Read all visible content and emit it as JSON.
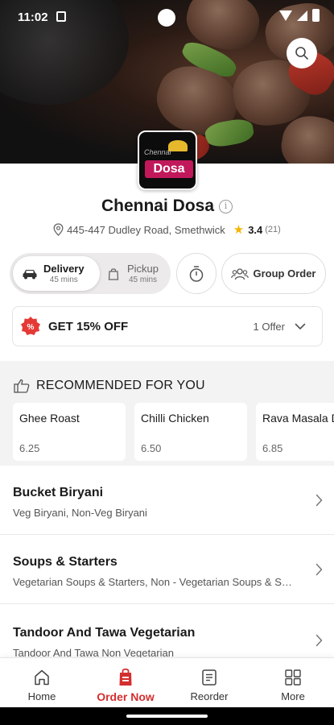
{
  "status_bar": {
    "time": "11:02"
  },
  "restaurant": {
    "name": "Chennai Dosa",
    "logo_small_text": "Chennai",
    "logo_text": "Dosa",
    "address": "445-447 Dudley Road, Smethwick",
    "rating": "3.4",
    "rating_count": "(21)"
  },
  "order_modes": {
    "delivery": {
      "label": "Delivery",
      "time": "45 mins",
      "selected": true
    },
    "pickup": {
      "label": "Pickup",
      "time": "45 mins",
      "selected": false
    }
  },
  "group_order_label": "Group Order",
  "offer": {
    "title": "GET 15% OFF",
    "count": "1 Offer"
  },
  "recommended": {
    "heading": "RECOMMENDED FOR YOU",
    "items": [
      {
        "name": "Ghee Roast",
        "price": "6.25"
      },
      {
        "name": "Chilli Chicken",
        "price": "6.50"
      },
      {
        "name": "Rava Masala Dosa",
        "price": "6.85"
      }
    ]
  },
  "categories": [
    {
      "name": "Bucket Biryani",
      "description": "Veg Biryani, Non-Veg Biryani"
    },
    {
      "name": "Soups & Starters",
      "description": "Vegetarian Soups & Starters, Non - Vegetarian Soups & Starters"
    },
    {
      "name": "Tandoor And Tawa Vegetarian",
      "description": "Tandoor And Tawa Non Vegetarian"
    }
  ],
  "bottom_nav": [
    {
      "label": "Home",
      "icon": "home-icon"
    },
    {
      "label": "Order Now",
      "icon": "order-bag-icon",
      "active": true
    },
    {
      "label": "Reorder",
      "icon": "receipt-icon"
    },
    {
      "label": "More",
      "icon": "grid-icon"
    }
  ],
  "colors": {
    "accent": "#d32f2f",
    "brand_pink": "#c1185b",
    "star": "#f5b400"
  }
}
